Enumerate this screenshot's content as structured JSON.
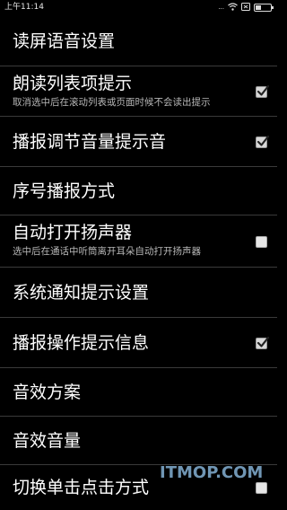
{
  "status_bar": {
    "time": "上午11:14",
    "signal_text": "...",
    "wifi_icon": "wifi-icon",
    "battery_icon": "battery-icon",
    "battery_level": 0.35
  },
  "settings": [
    {
      "title": "读屏语音设置"
    },
    {
      "title": "朗读列表项提示",
      "summary": "取消选中后在滚动列表或页面时候不会读出提示",
      "checkbox": true,
      "checked": true
    },
    {
      "title": "播报调节音量提示音",
      "checkbox": true,
      "checked": true
    },
    {
      "title": "序号播报方式"
    },
    {
      "title": "自动打开扬声器",
      "summary": "选中后在通话中听筒离开耳朵自动打开扬声器",
      "checkbox": true,
      "checked": false
    },
    {
      "title": "系统通知提示设置"
    },
    {
      "title": "播报操作提示信息",
      "checkbox": true,
      "checked": true
    },
    {
      "title": "音效方案"
    },
    {
      "title": "音效音量"
    },
    {
      "title": "切换单击点击方式",
      "checkbox": true,
      "checked": false
    }
  ],
  "watermark": {
    "brand": "ITMOP.COM",
    "logo_icon": "itmop-watermark-logo"
  },
  "colors": {
    "background": "#000000",
    "text": "#ffffff",
    "summary_text": "#b8b8b8",
    "divider": "#3a3a3a",
    "checkbox_fill": "#d8d8d8"
  }
}
